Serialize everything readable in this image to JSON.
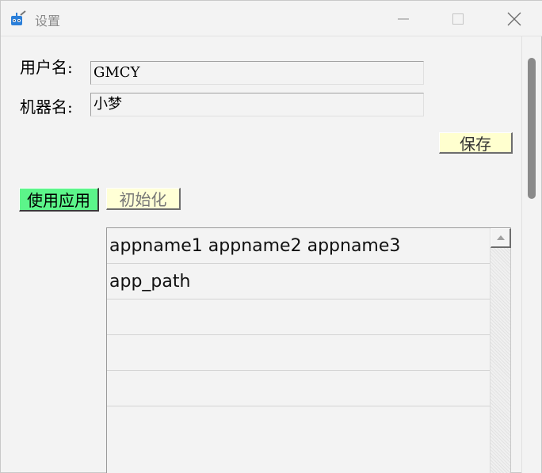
{
  "window": {
    "title": "设置",
    "icon": "app-robot-icon"
  },
  "form": {
    "username_label": "用户名:",
    "username_value": "GMCY",
    "machine_label": "机器名:",
    "machine_value": "小梦",
    "save_label": "保存"
  },
  "actions": {
    "use_app_label": "使用应用",
    "init_label": "初始化"
  },
  "list": {
    "rows": [
      "appname1 appname2 appname3",
      "app_path",
      "",
      "",
      ""
    ]
  },
  "colors": {
    "use_button_bg": "#5cf58a",
    "init_button_bg": "#ffffd6",
    "save_button_bg": "#ffffcf"
  }
}
